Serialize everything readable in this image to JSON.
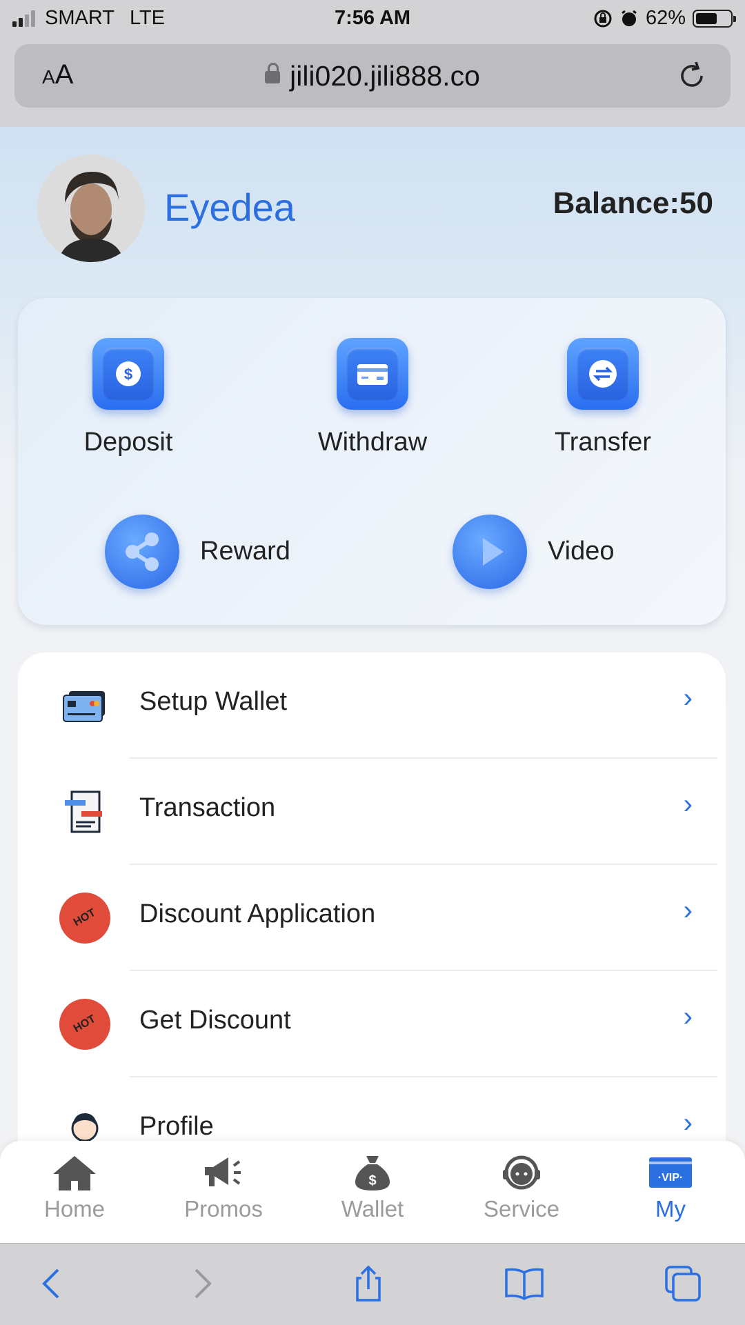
{
  "status_bar": {
    "carrier": "SMART",
    "network": "LTE",
    "time": "7:56 AM",
    "battery": "62%",
    "battery_level": 0.62
  },
  "browser": {
    "text_size_label": "AA",
    "url": "jili020.jili888.co"
  },
  "profile": {
    "username": "Eyedea",
    "balance_label": "Balance:50"
  },
  "actions": [
    {
      "label": "Deposit",
      "icon": "dollar-coin-icon"
    },
    {
      "label": "Withdraw",
      "icon": "card-icon"
    },
    {
      "label": "Transfer",
      "icon": "transfer-icon"
    },
    {
      "label": "Reward",
      "icon": "share-icon"
    },
    {
      "label": "Video",
      "icon": "play-icon"
    }
  ],
  "menu": [
    {
      "label": "Setup Wallet",
      "icon": "wallet-card-icon"
    },
    {
      "label": "Transaction",
      "icon": "receipt-icon"
    },
    {
      "label": "Discount Application",
      "icon": "hot-badge-icon",
      "badge": "HOT"
    },
    {
      "label": "Get Discount",
      "icon": "hot-badge-icon",
      "badge": "HOT"
    },
    {
      "label": "Profile",
      "icon": "person-icon"
    }
  ],
  "tabs": [
    {
      "label": "Home",
      "icon": "home-icon"
    },
    {
      "label": "Promos",
      "icon": "megaphone-icon"
    },
    {
      "label": "Wallet",
      "icon": "money-bag-icon"
    },
    {
      "label": "Service",
      "icon": "headset-icon"
    },
    {
      "label": "My",
      "icon": "vip-icon",
      "badge": "VIP",
      "active": true
    }
  ],
  "colors": {
    "accent": "#2b6fe0",
    "inactive_tab": "#9b9b9b",
    "hot": "#e04b3a"
  }
}
